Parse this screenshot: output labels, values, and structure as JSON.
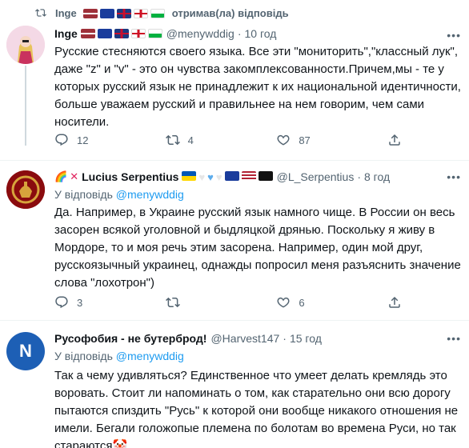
{
  "retweet_bar": {
    "user": "Inge",
    "action": "отримав(ла) відповідь"
  },
  "tweets": [
    {
      "name": "Inge",
      "handle": "@menywddig",
      "time": "10 год",
      "text": "Русские стесняются своего языка. Все эти \"мониторить\",\"классный лук\", даже \"z\" и \"v\" - это он чувства закомплексованности.Причем,мы - те у которых русский язык не принадлежит к их национальной идентичности, больше уважаем русский и правильнее на нем говорим, чем сами носители.",
      "replies": "12",
      "retweets": "4",
      "likes": "87"
    },
    {
      "name": "Lucius Serpentius",
      "handle": "@L_Serpentius",
      "time": "8 год",
      "reply_prefix": "У відповідь",
      "reply_mention": "@menywddig",
      "text": "Да. Например, в Украине русский язык намного чище. В России он весь засорен всякой уголовной и быдляцкой дрянью. Поскольку я живу в Мордоре, то и моя речь этим засорена. Например, один мой друг, русскоязычный украинец, однажды попросил меня разъяснить значение слова \"лохотрон\")",
      "replies": "3",
      "retweets": "",
      "likes": "6"
    },
    {
      "name": "Русофобия - не бутерброд!",
      "handle": "@Harvest147",
      "time": "15 год",
      "reply_prefix": "У відповідь",
      "reply_mention": "@menywddig",
      "avatar_letter": "N",
      "text": "Так а чему удивляться? Единственное что умеет делать кремлядь это воровать. Стоит ли напоминать о том, как старательно они всю дорогу пытаются спиздить \"Русь\" к которой они вообще никакого отношения не имели. Бегали голожопые племена по болотам во времена Руси, но так стараются🤡"
    }
  ],
  "colors": {
    "accent": "#1d9bf0",
    "muted": "#536471",
    "text": "#0f1419"
  },
  "icons": [
    "retweet-icon",
    "reply-icon",
    "like-icon",
    "more-icon",
    "rainbow-icon",
    "cross-mark-icon"
  ]
}
